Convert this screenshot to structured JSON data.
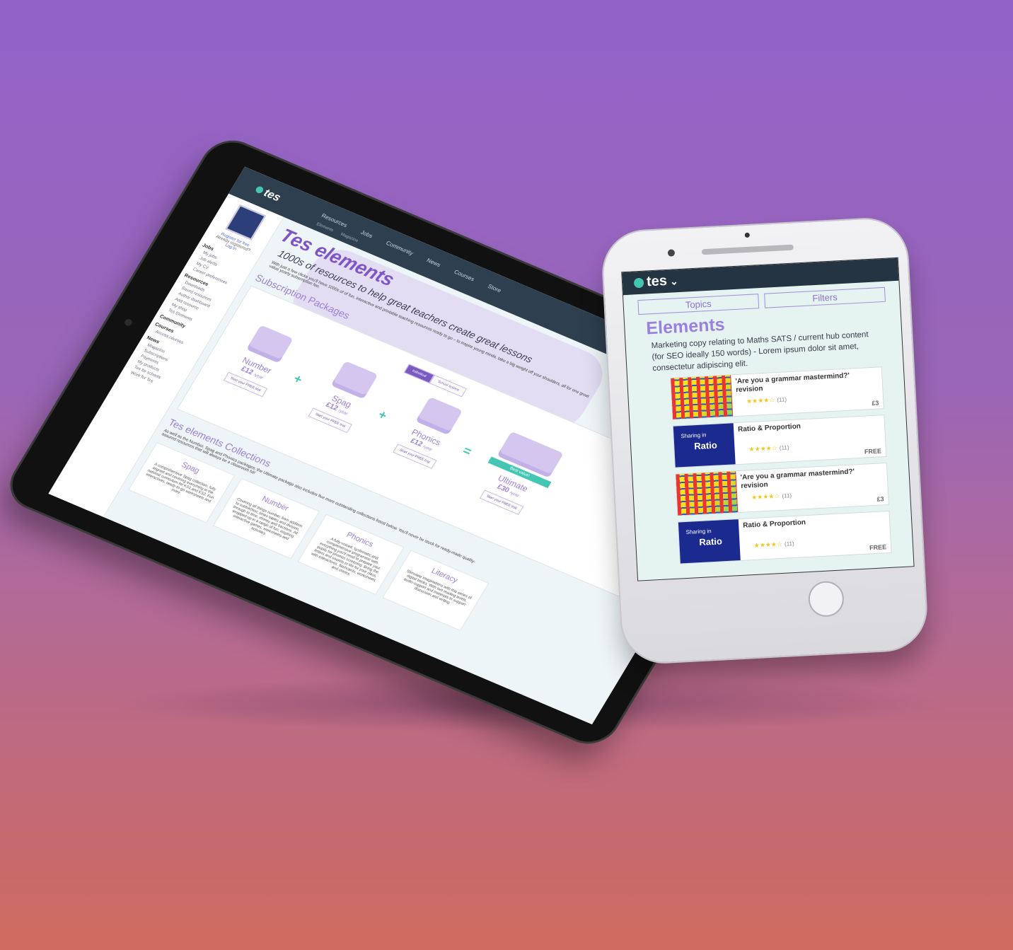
{
  "tablet": {
    "brand": "tes",
    "nav": [
      "Resources",
      "Jobs",
      "Community",
      "News",
      "Courses",
      "Store"
    ],
    "subnav": [
      "Elements",
      "Magazine"
    ],
    "sidebar": {
      "register": "Register for free",
      "already": "Already registered?",
      "login": "Log in",
      "sections": [
        {
          "heading": "Jobs",
          "items": [
            "My jobs",
            "Job alerts",
            "My CV",
            "Career preferences"
          ]
        },
        {
          "heading": "Resources",
          "items": [
            "Downloads",
            "Saved resources",
            "Author dashboard",
            "Add resource",
            "My shop",
            "Tes Elements"
          ]
        },
        {
          "heading": "Community",
          "items": []
        },
        {
          "heading": "Courses",
          "items": [
            "Access courses"
          ]
        },
        {
          "heading": "News",
          "items": [
            "Magazine",
            "Subscriptions",
            "Payments"
          ]
        },
        {
          "heading": "",
          "items": [
            "My products",
            "Tes for schools",
            "Work for Tes"
          ]
        }
      ]
    },
    "title": "Tes elements",
    "subtitle": "1000s of resources to help great teachers create great lessons",
    "intro": "With just a few clicks you'll have 1000s of of fun, interactive and printable teaching resources ready to go – to inspire young minds, take a big weight off your shoulders, all for one great value yearly subscription fee.",
    "packages_heading": "Subscription Packages",
    "toggle": [
      "Individual",
      "School licence"
    ],
    "packages": [
      {
        "name": "Number",
        "price": "£12",
        "per": "/year",
        "cta": "Start your FREE trial"
      },
      {
        "name": "Spag",
        "price": "£12",
        "per": "/year",
        "cta": "Start your FREE trial"
      },
      {
        "name": "Phonics",
        "price": "£12",
        "per": "/year",
        "cta": "Start your FREE trial"
      },
      {
        "name": "Ultimate",
        "price": "£30",
        "per": "/year",
        "cta": "Start your FREE trial",
        "ribbon": "Best value!"
      }
    ],
    "collections_heading": "Tes elements Collections",
    "collections_note": "As well as the Number, Spag and Phonics packages, the Ultimate package also includes five more outstanding collections listed below. You'll never be stuck for ready-made quality-assured resources that will always be a classroom hit!",
    "collections": [
      {
        "name": "Spag",
        "text": "A comprehensive Spag collection, fully aligned and covering everything in the national curriculum for KS1 and KS2. Fun interactives, ready-to-go worksheets and more."
      },
      {
        "name": "Number",
        "text": "Covering all things number, from addition to subtraction, times tables and division, through to time, money and fractions. All wrapped up in a range of fun, inspiring interactive games, worksheets and activities."
      },
      {
        "name": "Phonics",
        "text": "A fully-voiced, systematic and comprehensive programme with everything you'll need to prepare your pupils for phonics screening. Bring the letters and sounds to life for your class, with interactives, flashcards, worksheets and stories."
      },
      {
        "name": "Literacy",
        "text": "Stimulate imaginations with this series of digital books. With two reading levels, audio-support and materials to support discussion and writing."
      }
    ]
  },
  "phone": {
    "brand": "tes",
    "tabs": [
      "Topics",
      "Filters"
    ],
    "title": "Elements",
    "copy": "Marketing copy relating to Maths SATS / current hub content (for SEO ideally 150 words) - Lorem ipsum dolor sit amet, consectetur adipiscing elit.",
    "cards": [
      {
        "title": "'Are you a grammar mastermind?' revision",
        "rating": 4,
        "count": "(11)",
        "price": "£3",
        "thumb": "grid",
        "thumb_text": "",
        "thumb_big": ""
      },
      {
        "title": "Ratio & Proportion",
        "rating": 4,
        "count": "(11)",
        "price": "FREE",
        "thumb": "blue",
        "thumb_text": "Sharing in",
        "thumb_big": "Ratio"
      },
      {
        "title": "'Are you a grammar mastermind?' revision",
        "rating": 4,
        "count": "(11)",
        "price": "£3",
        "thumb": "grid",
        "thumb_text": "",
        "thumb_big": ""
      },
      {
        "title": "Ratio & Proportion",
        "rating": 4,
        "count": "(11)",
        "price": "FREE",
        "thumb": "blue",
        "thumb_text": "Sharing in",
        "thumb_big": "Ratio"
      }
    ]
  },
  "colors": {
    "accent": "#7f55c6",
    "teal": "#43c6b4",
    "nav": "#2e3f4f"
  }
}
